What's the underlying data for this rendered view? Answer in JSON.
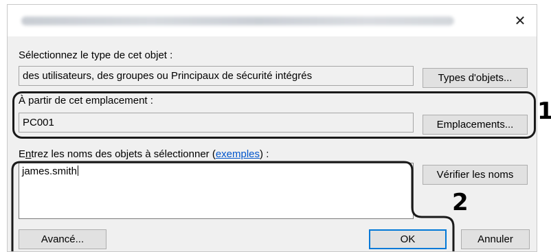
{
  "dialog": {
    "close_glyph": "✕",
    "object_type": {
      "label": "Sélectionnez le type de cet objet :",
      "value": "des utilisateurs, des groupes ou Principaux de sécurité intégrés",
      "button": "Types d'objets..."
    },
    "location": {
      "label": "À partir de cet emplacement :",
      "value": "PC001",
      "button": "Emplacements..."
    },
    "names": {
      "label_prefix": "E",
      "label_accel": "n",
      "label_rest": "trez les noms des objets à sélectionner (",
      "link": "exemples",
      "label_suffix": ") :",
      "value": "james.smith",
      "check_button": "Vérifier les noms"
    },
    "buttons": {
      "advanced": "Avancé...",
      "ok": "OK",
      "cancel": "Annuler"
    }
  },
  "callouts": {
    "one": "1",
    "two": "2",
    "color": "#1a1a1a"
  }
}
